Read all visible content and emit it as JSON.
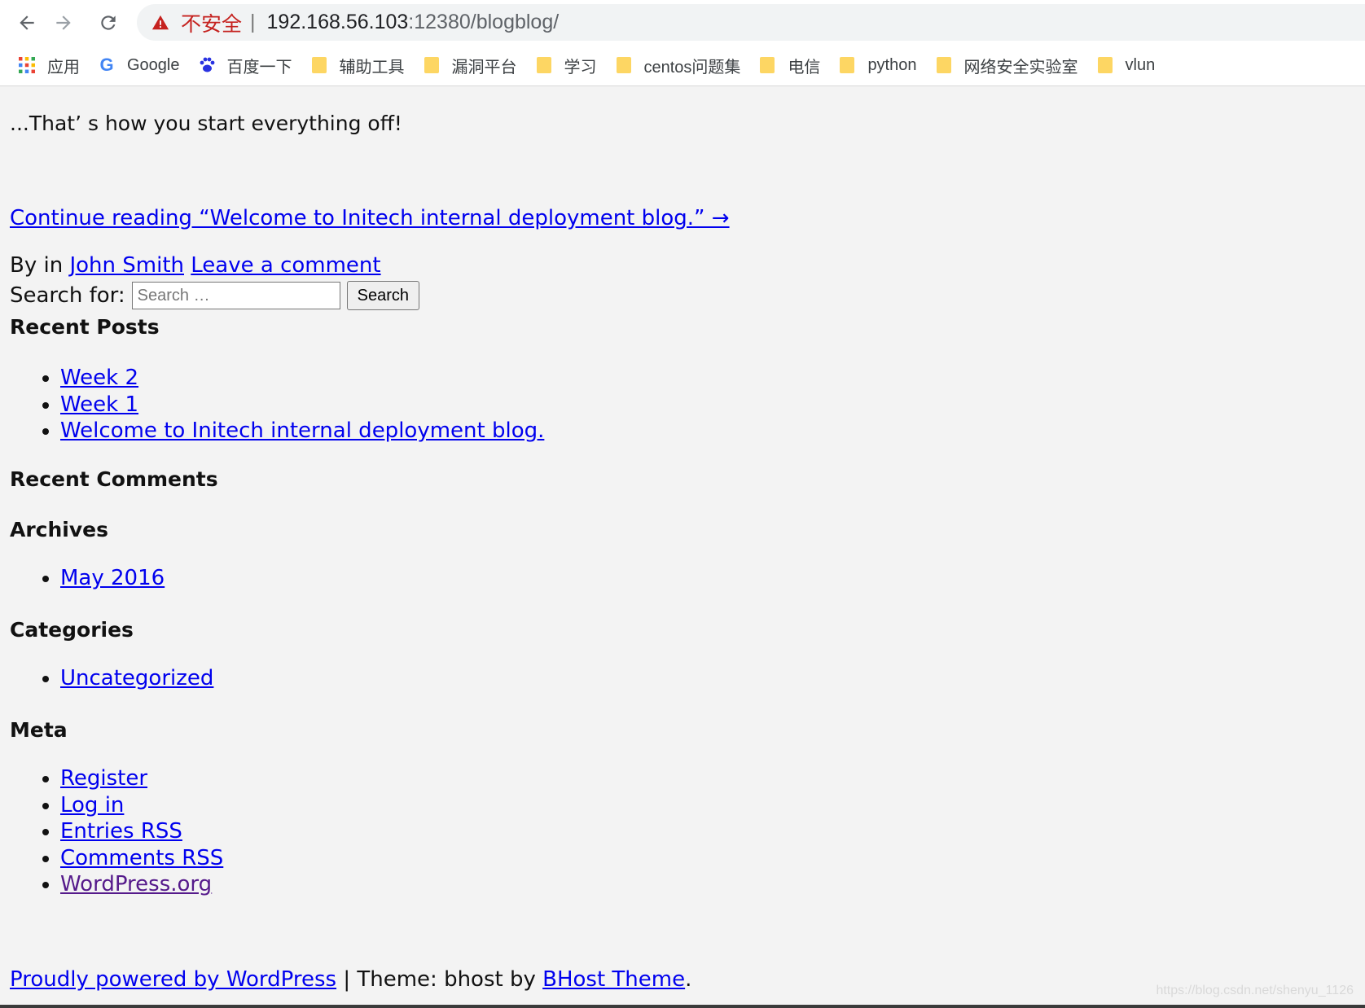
{
  "browser": {
    "security_label": "不安全",
    "separator": "|",
    "url_host": "192.168.56.103",
    "url_rest": ":12380/blogblog/",
    "bookmarks": [
      {
        "label": "应用",
        "icon": "apps-grid-icon"
      },
      {
        "label": "Google",
        "icon": "google-icon"
      },
      {
        "label": "百度一下",
        "icon": "baidu-paw-icon"
      },
      {
        "label": "辅助工具",
        "icon": "folder-icon"
      },
      {
        "label": "漏洞平台",
        "icon": "folder-icon"
      },
      {
        "label": "学习",
        "icon": "folder-icon"
      },
      {
        "label": "centos问题集",
        "icon": "folder-icon"
      },
      {
        "label": "电信",
        "icon": "folder-icon"
      },
      {
        "label": "python",
        "icon": "folder-icon"
      },
      {
        "label": "网络安全实验室",
        "icon": "folder-icon"
      },
      {
        "label": "vlun",
        "icon": "folder-icon"
      }
    ]
  },
  "post": {
    "excerpt": "...That’ s how you start everything off!",
    "continue_link": "Continue reading  “Welcome to Initech internal deployment blog.”  →",
    "byline_prefix": "By in",
    "author": "John Smith",
    "comment_link": "Leave a comment"
  },
  "search": {
    "label": "Search for:",
    "placeholder": "Search …",
    "button": "Search"
  },
  "widgets": {
    "recent_posts": {
      "title": "Recent Posts",
      "items": [
        "Week 2",
        "Week 1",
        "Welcome to Initech internal deployment blog."
      ]
    },
    "recent_comments": {
      "title": "Recent Comments"
    },
    "archives": {
      "title": "Archives",
      "items": [
        "May 2016"
      ]
    },
    "categories": {
      "title": "Categories",
      "items": [
        "Uncategorized"
      ]
    },
    "meta": {
      "title": "Meta",
      "items": [
        "Register",
        "Log in",
        "Entries RSS",
        "Comments RSS",
        "WordPress.org"
      ]
    }
  },
  "footer": {
    "powered": "Proudly powered by WordPress",
    "separator": " | Theme: bhost by ",
    "theme_link": "BHost Theme",
    "period": "."
  },
  "watermark": "https://blog.csdn.net/shenyu_1126",
  "colors": {
    "link": "#0000ee",
    "visited": "#551a8b",
    "insecure": "#c5221f",
    "folder": "#fdd663"
  }
}
